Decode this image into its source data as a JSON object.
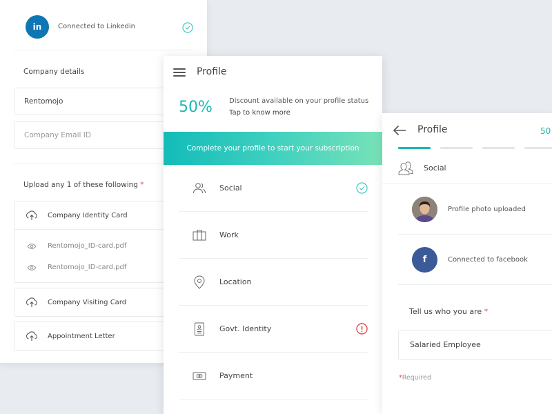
{
  "left_card": {
    "linkedin": {
      "badge": "in",
      "text": "Connected to Linkedin",
      "status_icon": "check-circle-icon",
      "brand_color": "#0f76b4"
    },
    "company_details": {
      "title": "Company details",
      "company_name_value": "Rentomojo",
      "company_email_placeholder": "Company Email ID"
    },
    "upload": {
      "title": "Upload any 1 of these following",
      "required_mark": "*",
      "items": [
        {
          "label": "Company Identity Card",
          "icon": "upload-cloud-icon",
          "files": [
            {
              "name": "Rentomojo_ID-card.pdf",
              "icon": "eye-icon"
            },
            {
              "name": "Rentomojo_ID-card.pdf",
              "icon": "eye-icon"
            }
          ]
        },
        {
          "label": "Company Visiting Card",
          "icon": "upload-cloud-icon"
        },
        {
          "label": "Appointment Letter",
          "icon": "upload-cloud-icon"
        }
      ]
    }
  },
  "middle_card": {
    "header": {
      "menu_icon": "hamburger-icon",
      "title": "Profile"
    },
    "discount": {
      "percent": "50%",
      "line1": "Discount available on your profile status",
      "line2": "Tap to know more"
    },
    "cta": {
      "label": "Complete your profile to start your subscription"
    },
    "menu": [
      {
        "label": "Social",
        "icon": "users-icon",
        "status": "complete"
      },
      {
        "label": "Work",
        "icon": "briefcase-icon",
        "status": ""
      },
      {
        "label": "Location",
        "icon": "location-pin-icon",
        "status": ""
      },
      {
        "label": "Govt. Identity",
        "icon": "id-card-icon",
        "status": "error"
      },
      {
        "label": "Payment",
        "icon": "payment-card-icon",
        "status": ""
      }
    ]
  },
  "right_card": {
    "header": {
      "back_icon": "back-arrow-icon",
      "title": "Profile",
      "percent": "50"
    },
    "stepper": {
      "total_steps": 4,
      "current_step": 1
    },
    "section": {
      "icon": "users-icon",
      "label": "Social"
    },
    "connections": [
      {
        "text": "Profile photo uploaded",
        "type": "avatar"
      },
      {
        "text": "Connected to facebook",
        "type": "facebook",
        "badge": "f"
      }
    ],
    "who": {
      "label": "Tell us who you are",
      "required_mark": "*",
      "value": "Salaried Employee"
    },
    "required_note": {
      "mark": "*",
      "text": "Required"
    }
  },
  "colors": {
    "accent": "#1bb8b3",
    "error": "#e14b4b",
    "facebook": "#3b5a9a",
    "linkedin": "#0f76b4",
    "background": "#e8ecf0"
  }
}
